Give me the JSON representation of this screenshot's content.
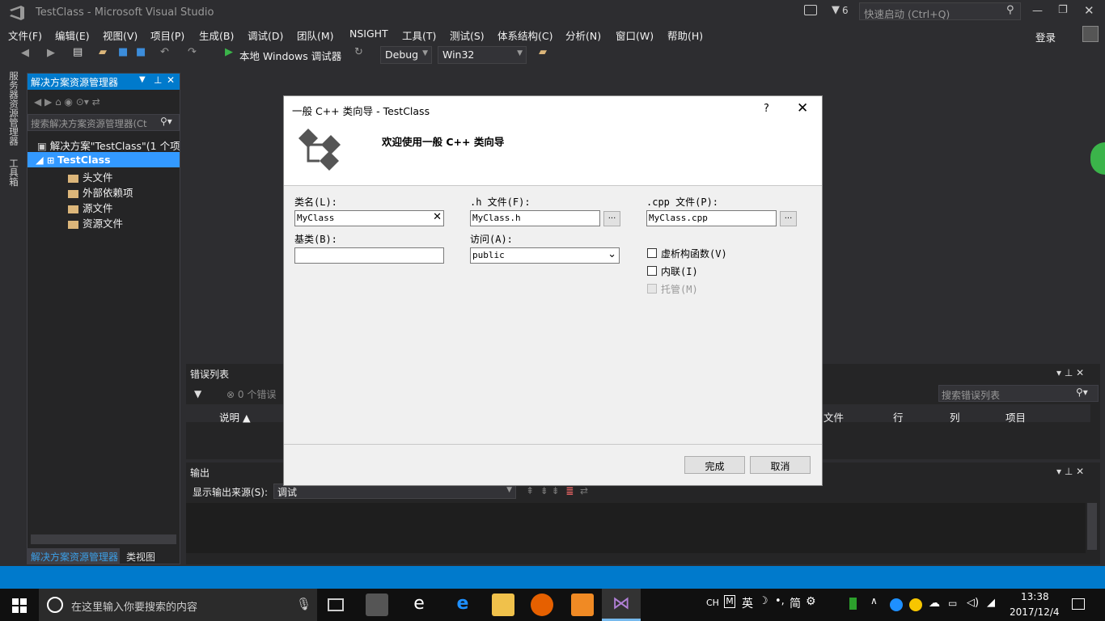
{
  "window": {
    "title": "TestClass - Microsoft Visual Studio",
    "notif_count": "6",
    "quick_launch": "快速启动 (Ctrl+Q)",
    "login": "登录"
  },
  "menu": [
    "文件(F)",
    "编辑(E)",
    "视图(V)",
    "项目(P)",
    "生成(B)",
    "调试(D)",
    "团队(M)",
    "NSIGHT",
    "工具(T)",
    "测试(S)",
    "体系结构(C)",
    "分析(N)",
    "窗口(W)",
    "帮助(H)"
  ],
  "toolbar": {
    "debugger": "本地 Windows 调试器",
    "config": "Debug",
    "platform": "Win32"
  },
  "left_strip": {
    "server_explorer": "服务器资源管理器",
    "toolbox": "工具箱"
  },
  "solution_explorer": {
    "title": "解决方案资源管理器",
    "search": "搜索解决方案资源管理器(Ct",
    "solution": "解决方案\"TestClass\"(1 个项目",
    "project": "TestClass",
    "items": [
      "头文件",
      "外部依赖项",
      "源文件",
      "资源文件"
    ],
    "tab1": "解决方案资源管理器",
    "tab2": "类视图"
  },
  "error_list": {
    "title": "错误列表",
    "errors": "0 个错误",
    "search": "搜索错误列表",
    "cols": [
      "说明",
      "文件",
      "行",
      "列",
      "项目"
    ]
  },
  "output": {
    "title": "输出",
    "source_label": "显示输出来源(S):",
    "source": "调试"
  },
  "dialog": {
    "title": "一般 C++ 类向导 - TestClass",
    "help": "?",
    "heading": "欢迎使用一般 C++ 类向导",
    "class_label": "类名(L):",
    "class_value": "MyClass",
    "h_label": ".h 文件(F):",
    "h_value": "MyClass.h",
    "cpp_label": ".cpp 文件(P):",
    "cpp_value": "MyClass.cpp",
    "base_label": "基类(B):",
    "base_value": "",
    "access_label": "访问(A):",
    "access_value": "public",
    "virtual_dtor": "虚析构函数(V)",
    "inline": "内联(I)",
    "managed": "托管(M)",
    "finish": "完成",
    "cancel": "取消",
    "browse": "..."
  },
  "taskbar": {
    "search": "在这里输入你要搜索的内容",
    "time": "13:38",
    "date": "2017/12/4",
    "ime1": "CH",
    "ime2": "英",
    "ime3": "简"
  }
}
